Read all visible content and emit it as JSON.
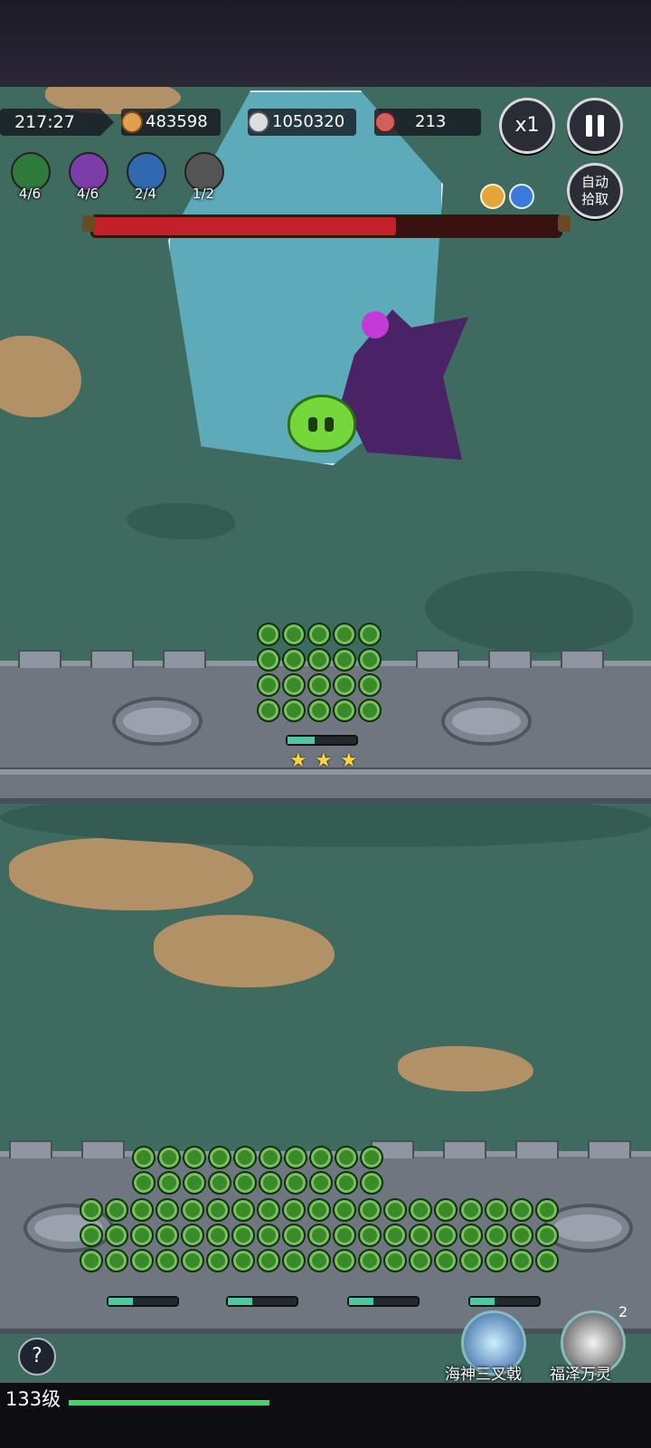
{
  "hud": {
    "timer": "217:27",
    "coins": "483598",
    "kills": "1050320",
    "gems": "213",
    "speed_label": "x1",
    "pause_icon": "pause-icon",
    "auto_pickup_label": "自动\n拾取"
  },
  "skills": [
    {
      "icon": "sword-icon",
      "count": "4/6",
      "color": "#2e7a3b"
    },
    {
      "icon": "gear-icon",
      "count": "4/6",
      "color": "#7b3ea8"
    },
    {
      "icon": "lightning-icon",
      "count": "2/4",
      "color": "#2f6ab0"
    },
    {
      "icon": "claw-icon",
      "count": "1/2",
      "color": "#555555"
    }
  ],
  "boss": {
    "hp_fraction": 0.65
  },
  "player": {
    "level_label": "133级",
    "xp_fraction": 1.0
  },
  "ultimates": [
    {
      "label": "海神三叉戟",
      "icon": "trident-icon"
    },
    {
      "label": "福泽万灵",
      "icon": "spirit-icon",
      "charges": "2"
    }
  ],
  "help_label": "?",
  "colors": {
    "grass": "#3e6a5f",
    "boss_hp": "#c3202a",
    "xp": "#46d36a"
  }
}
